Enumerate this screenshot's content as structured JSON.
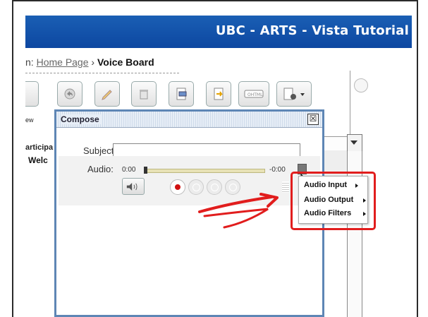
{
  "header": {
    "title": "UBC - ARTS - Vista Tutorial"
  },
  "breadcrumb": {
    "prefix": "n:",
    "home": "Home Page",
    "separator": "›",
    "current": "Voice Board"
  },
  "left_panel": {
    "view_label": "ew",
    "participants_label": "articipa",
    "welcome_label": "Welc"
  },
  "compose": {
    "title": "Compose",
    "close": "☒",
    "subject_label": "Subject",
    "subject_value": "",
    "audio_label": "Audio:",
    "time_start": "0:00",
    "time_end": "-0:00",
    "position_fraction": 0.0
  },
  "audio_menu": {
    "items": [
      {
        "label": "Audio Input"
      },
      {
        "label": "Audio Output"
      },
      {
        "label": "Audio Filters"
      }
    ]
  },
  "colors": {
    "header_bg": "#0d47a1",
    "annotation": "#e11d1d",
    "dialog_border": "#5e86b5",
    "record": "#d01010"
  }
}
